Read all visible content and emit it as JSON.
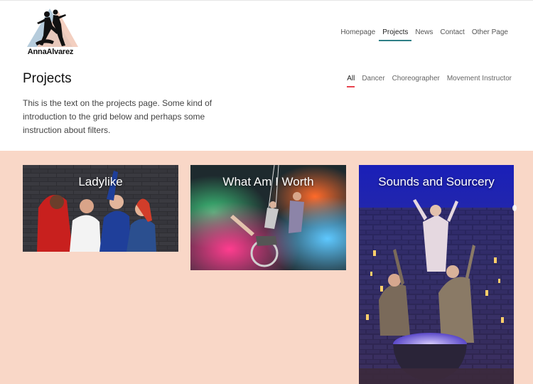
{
  "site": {
    "logo_text": "AnnaAlvarez",
    "nav": [
      {
        "label": "Homepage",
        "active": false
      },
      {
        "label": "Projects",
        "active": true
      },
      {
        "label": "News",
        "active": false
      },
      {
        "label": "Contact",
        "active": false
      },
      {
        "label": "Other Page",
        "active": false
      }
    ]
  },
  "main": {
    "title": "Projects",
    "intro": "This is the text on the projects page.  Some kind of introduction to the grid below and perhaps some instruction about filters.",
    "filters": [
      {
        "label": "All",
        "active": true
      },
      {
        "label": "Dancer",
        "active": false
      },
      {
        "label": "Choreographer",
        "active": false
      },
      {
        "label": "Movement Instructor",
        "active": false
      }
    ]
  },
  "projects": [
    {
      "title": "Ladylike"
    },
    {
      "title": "What Am I Worth"
    },
    {
      "title": "Sounds and Sourcery"
    }
  ],
  "colors": {
    "grid_background": "#f9d7c7",
    "nav_underline": "#2f7f86",
    "filter_underline": "#e8434f"
  }
}
